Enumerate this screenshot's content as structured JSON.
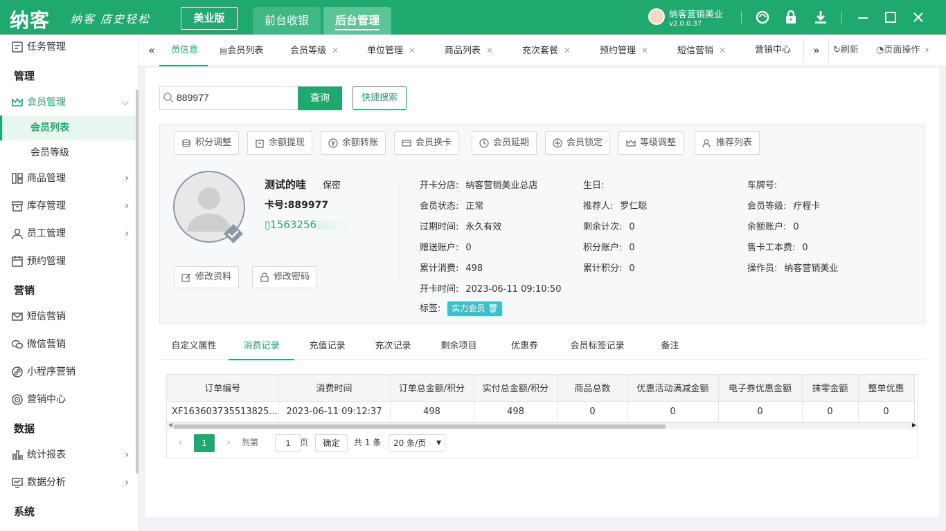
{
  "app": {
    "logo": "纳客",
    "slogan": "纳客 店史轻松",
    "edition_btn": "美业版",
    "top_tabs": [
      "前台收银",
      "后台管理"
    ],
    "user_name": "纳客营销美业",
    "version": "v2.0.0.37"
  },
  "sidebar": {
    "items": [
      {
        "label": "任务管理",
        "icon": "task-icon"
      },
      {
        "section": "管理"
      },
      {
        "label": "会员管理",
        "icon": "crown-icon"
      },
      {
        "sub": "会员列表"
      },
      {
        "sub": "会员等级"
      },
      {
        "label": "商品管理",
        "icon": "goods-icon"
      },
      {
        "label": "库存管理",
        "icon": "inventory-icon"
      },
      {
        "label": "员工管理",
        "icon": "staff-icon"
      },
      {
        "label": "预约管理",
        "icon": "calendar-icon"
      },
      {
        "section": "营销"
      },
      {
        "label": "短信营销",
        "icon": "sms-icon"
      },
      {
        "label": "微信营销",
        "icon": "wechat-icon"
      },
      {
        "label": "小程序营销",
        "icon": "miniapp-icon"
      },
      {
        "label": "营销中心",
        "icon": "target-icon"
      },
      {
        "section": "数据"
      },
      {
        "label": "统计报表",
        "icon": "chart-icon"
      },
      {
        "label": "数据分析",
        "icon": "analysis-icon"
      },
      {
        "section": "系统"
      }
    ]
  },
  "tabs": {
    "items": [
      "员信息",
      "会员列表",
      "会员等级",
      "单位管理",
      "商品列表",
      "充次套餐",
      "预约管理",
      "短信营销",
      "营销中心"
    ],
    "refresh": "刷新",
    "page_ops": "页面操作"
  },
  "search": {
    "value": "889977",
    "query_btn": "查询",
    "quick_btn": "快捷搜索"
  },
  "actions": [
    "积分调整",
    "余额提现",
    "余额转账",
    "会员换卡",
    "会员延期",
    "会员锁定",
    "等级调整",
    "推荐列表"
  ],
  "member": {
    "name": "测试的哇",
    "privacy": "保密",
    "card_label": "卡号:",
    "card_no": "889977",
    "phone": "1563256",
    "edit_btn": "修改资料",
    "pwd_btn": "修改密码"
  },
  "info": {
    "col1": [
      [
        "开卡分店:",
        "纳客营销美业总店"
      ],
      [
        "会员状态:",
        "正常"
      ],
      [
        "过期时间:",
        "永久有效"
      ],
      [
        "赠送账户:",
        "0"
      ],
      [
        "累计消费:",
        "498"
      ],
      [
        "开卡时间:",
        "2023-06-11 09:10:50"
      ],
      [
        "标签:",
        ""
      ]
    ],
    "col2": [
      [
        "生日:",
        ""
      ],
      [
        "推荐人:",
        "罗仁聪"
      ],
      [
        "剩余计次:",
        "0"
      ],
      [
        "积分账户:",
        "0"
      ],
      [
        "累计积分:",
        "0"
      ]
    ],
    "col3": [
      [
        "车牌号:",
        ""
      ],
      [
        "会员等级:",
        "疗程卡"
      ],
      [
        "余额账户:",
        "0"
      ],
      [
        "售卡工本费:",
        "0"
      ],
      [
        "操作员:",
        "纳客营销美业"
      ]
    ],
    "tag": "实力会员"
  },
  "subtabs": [
    "自定义属性",
    "消费记录",
    "充值记录",
    "充次记录",
    "剩余项目",
    "优惠券",
    "会员标签记录",
    "备注"
  ],
  "table": {
    "headers": [
      "订单编号",
      "消费时间",
      "订单总金额/积分",
      "实付总金额/积分",
      "商品总数",
      "优惠活动满减金额",
      "电子券优惠金额",
      "抹零金额",
      "整单优惠"
    ],
    "rows": [
      [
        "XF163603735513825...",
        "2023-06-11 09:12:37",
        "498",
        "498",
        "0",
        "0",
        "0",
        "0",
        "0"
      ]
    ]
  },
  "pager": {
    "current": "1",
    "goto": "到第",
    "page_input": "1",
    "page_unit": "页",
    "confirm": "确定",
    "total": "共 1 条",
    "per_page": "20 条/页"
  }
}
